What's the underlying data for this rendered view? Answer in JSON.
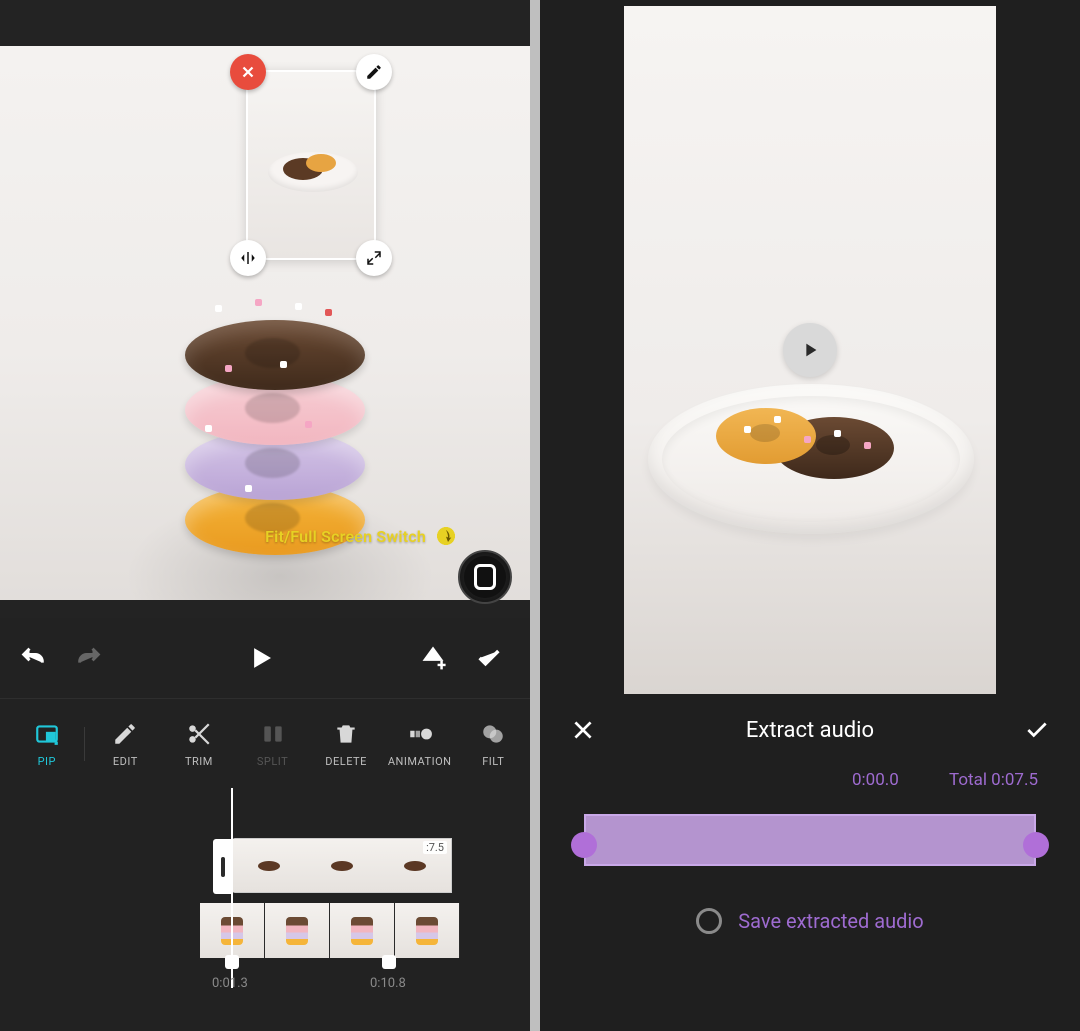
{
  "left": {
    "fit_hint": "Fit/Full Screen Switch",
    "tools": {
      "pip": "PIP",
      "edit": "EDIT",
      "trim": "TRIM",
      "split": "SPLIT",
      "delete": "DELETE",
      "animation": "ANIMATION",
      "filter": "FILT"
    },
    "timeline": {
      "clip_a_duration": ":7.5",
      "marker1_time": "0:01.3",
      "marker2_time": "0:10.8"
    }
  },
  "right": {
    "title": "Extract audio",
    "current_time": "0:00.0",
    "total_label": "Total 0:07.5",
    "save_label": "Save extracted audio"
  },
  "colors": {
    "accent_cyan": "#20c7d9",
    "accent_purple": "#9e6bd0",
    "range_fill": "#b494cf",
    "hint_yellow": "#e7d123",
    "pip_close": "#e84c3d"
  }
}
